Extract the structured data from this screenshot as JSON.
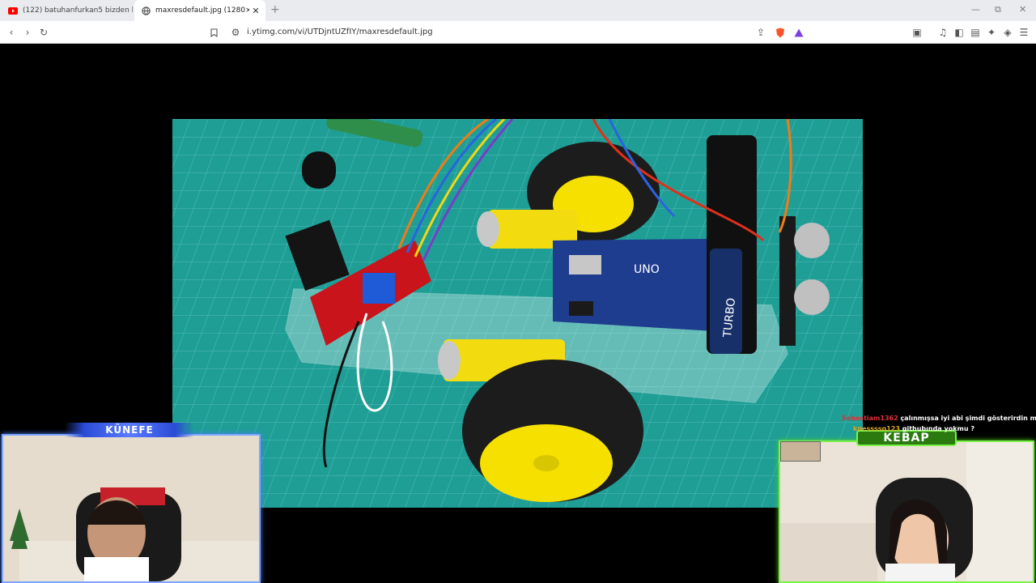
{
  "browser": {
    "tabs": [
      {
        "title": "(122) batuhanfurkan5 bizden biri ba",
        "icon": "youtube-icon"
      },
      {
        "title": "maxresdefault.jpg (1280×720)",
        "icon": "globe-icon"
      }
    ],
    "new_tab": "+",
    "address": "i.ytimg.com/vi/UTDjntUZfIY/maxresdefault.jpg"
  },
  "stream": {
    "left_cam_label": "KÜNEFE",
    "right_cam_label": "KEBAP",
    "chat": [
      {
        "user": "Sebastiam1362",
        "message": "çalınmışsa iyi abi şimdi gösterirdin mazallah",
        "user_color": "#e0303a"
      },
      {
        "user": "knessssq123",
        "message": "githubında yokmu ?",
        "user_color": "#d9a520"
      }
    ]
  },
  "photo": {
    "board_label": "UNO",
    "battery_label": "TURBO"
  },
  "colors": {
    "left_cam_accent": "#7ea7ff",
    "right_cam_accent": "#7cf24a",
    "mat": "#1f9e96",
    "wheel_hub": "#f5e000"
  }
}
